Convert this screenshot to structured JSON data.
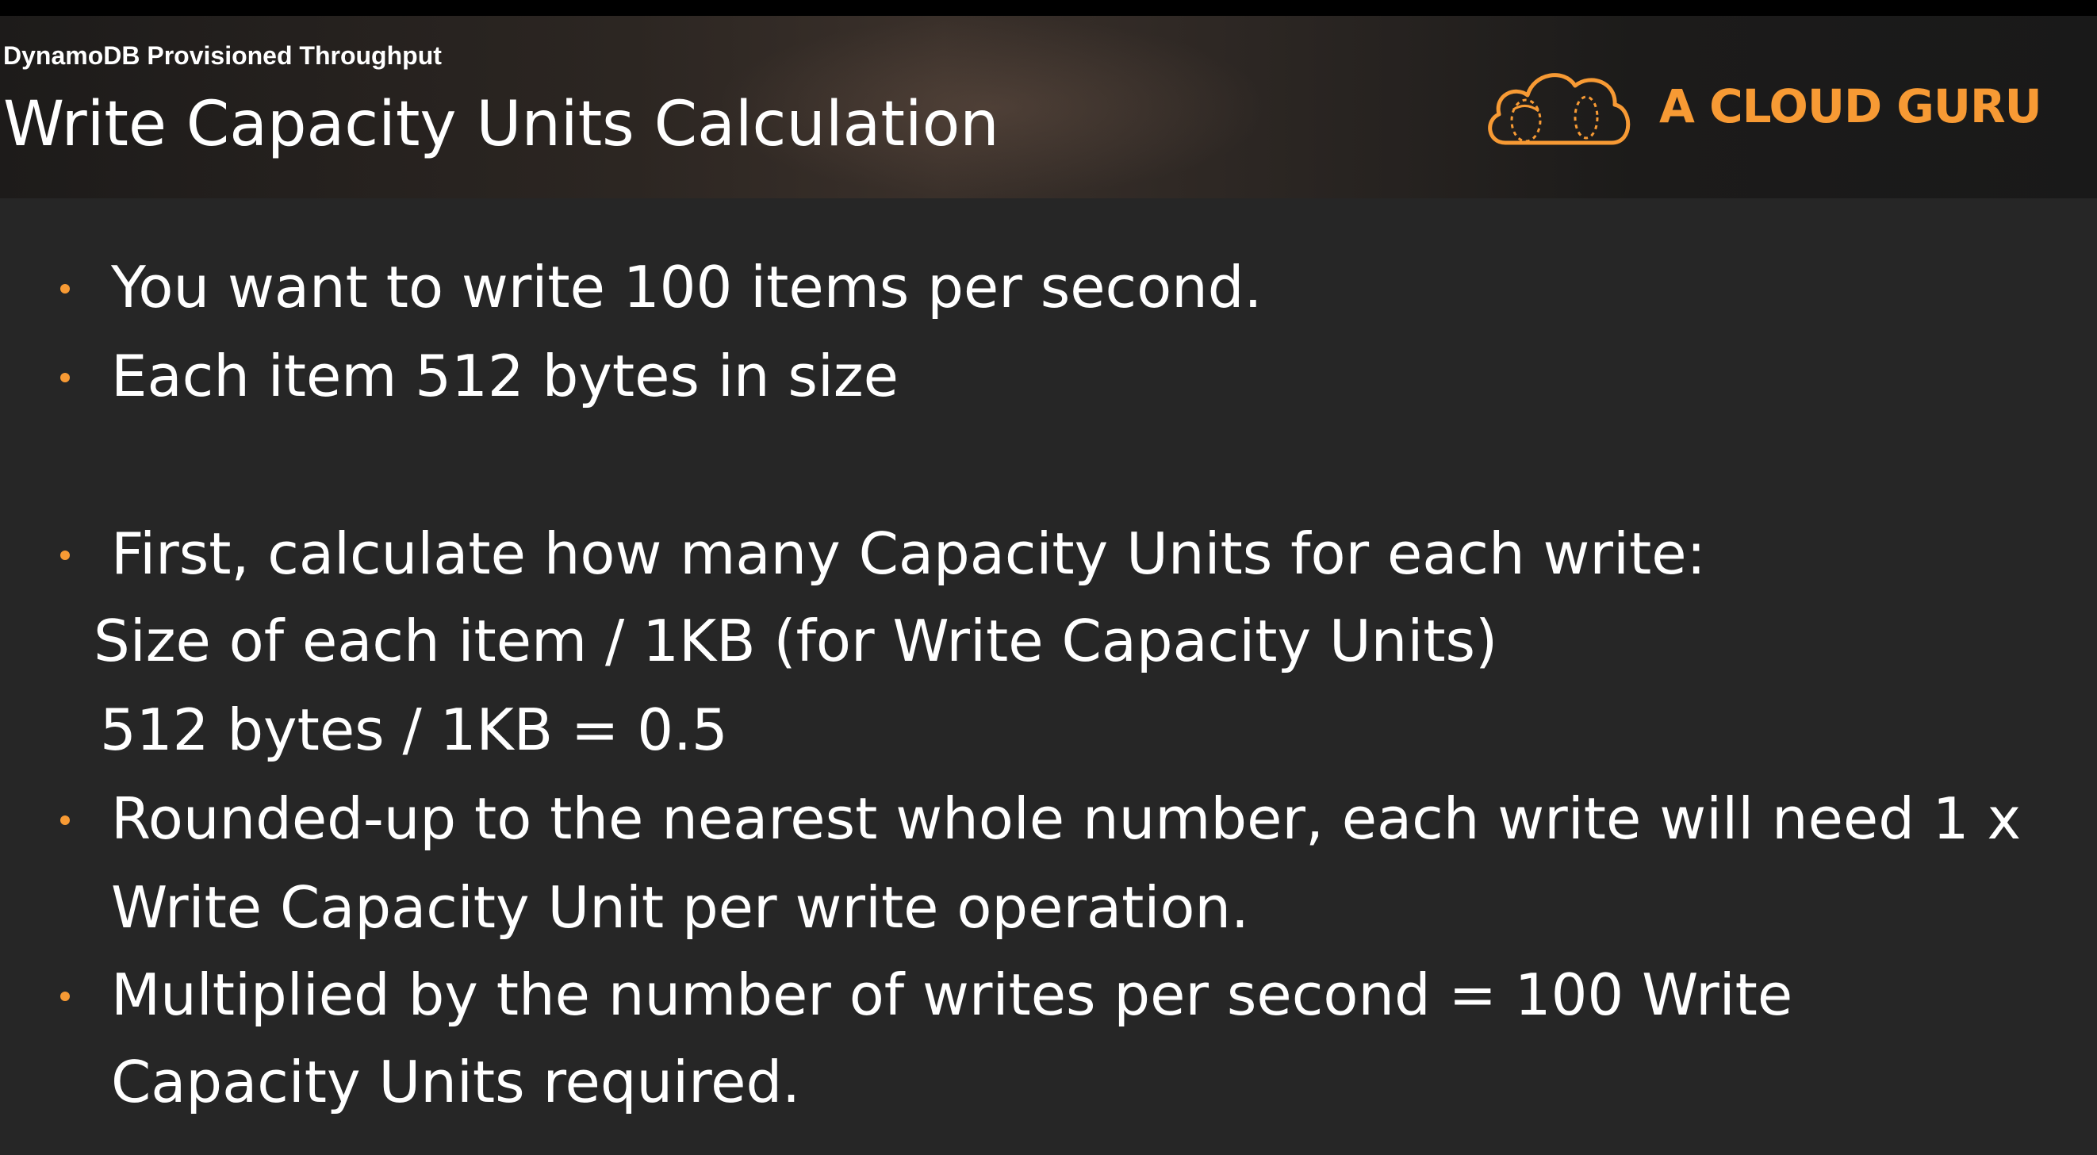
{
  "header": {
    "breadcrumb": "DynamoDB Provisioned Throughput",
    "title": "Write Capacity Units Calculation",
    "logo_text": "A CLOUD GURU",
    "logo_icon": "cloud-icon"
  },
  "colors": {
    "accent": "#f79a34",
    "background": "#262626",
    "text": "#ffffff"
  },
  "body": {
    "line_1": "You want to write 100 items per second.",
    "line_2": "Each item 512 bytes in size",
    "line_3": "First, calculate how many Capacity Units for each write:",
    "line_4": "Size of each item / 1KB (for Write Capacity Units)",
    "line_5": "512 bytes / 1KB = 0.5",
    "line_6": "Rounded-up to the nearest whole number, each write will need 1 x",
    "line_7": "Write Capacity Unit per write operation.",
    "line_8": "Multiplied by the number of writes per second = 100 Write",
    "line_9": "Capacity Units required."
  }
}
